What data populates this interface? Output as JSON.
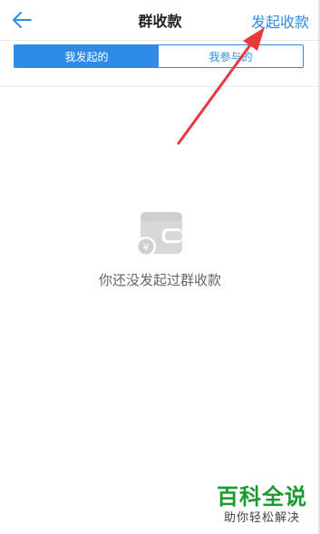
{
  "header": {
    "back_icon": "arrow-left-icon",
    "title": "群收款",
    "action_label": "发起收款"
  },
  "tabs": [
    {
      "label": "我发起的",
      "active": true
    },
    {
      "label": "我参与的",
      "active": false
    }
  ],
  "empty_state": {
    "icon": "wallet-yen-icon",
    "message": "你还没发起过群收款"
  },
  "watermark": {
    "main": "百科全说",
    "sub": "助你轻松解决"
  },
  "colors": {
    "accent": "#2f8bea",
    "annotation": "#e83a3a",
    "watermark": "#1a9a2f"
  }
}
